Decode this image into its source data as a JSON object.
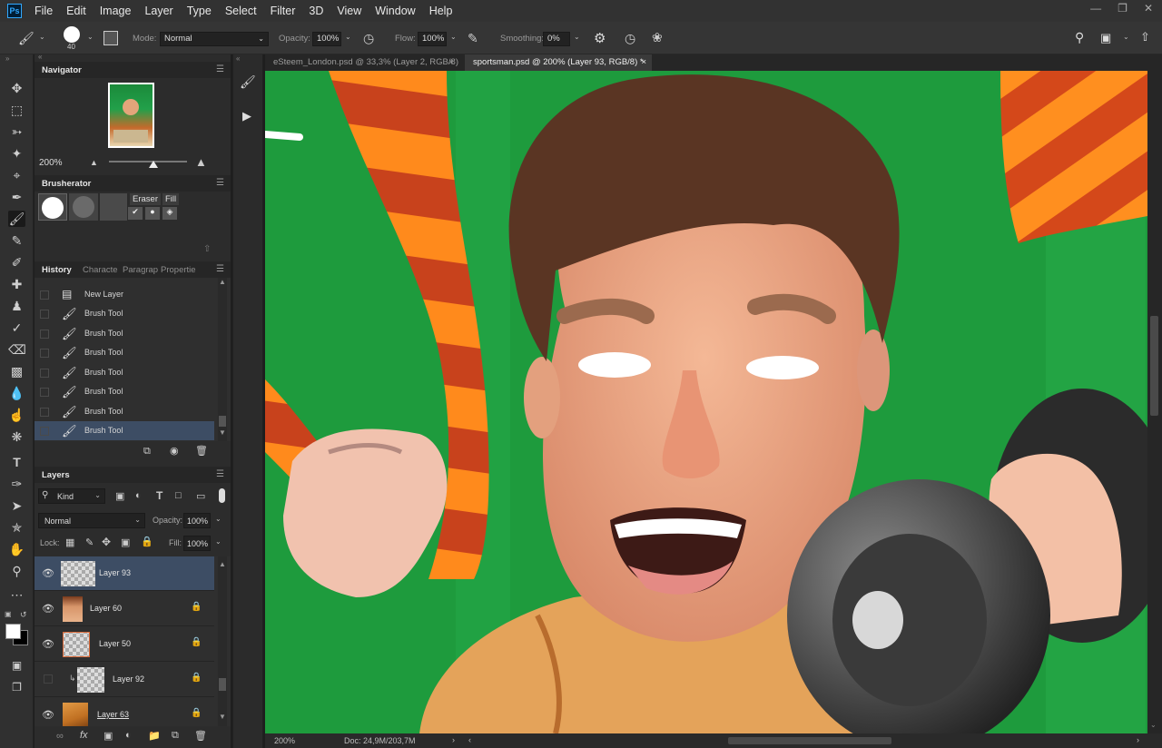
{
  "app": {
    "logo": "Ps",
    "menu": [
      "File",
      "Edit",
      "Image",
      "Layer",
      "Type",
      "Select",
      "Filter",
      "3D",
      "View",
      "Window",
      "Help"
    ]
  },
  "options": {
    "brush_size": "40",
    "mode_label": "Mode:",
    "mode_value": "Normal",
    "opacity_label": "Opacity:",
    "opacity_value": "100%",
    "flow_label": "Flow:",
    "flow_value": "100%",
    "smoothing_label": "Smoothing:",
    "smoothing_value": "0%"
  },
  "navigator": {
    "title": "Navigator",
    "zoom": "200%"
  },
  "brusherator": {
    "title": "Brusherator",
    "eraser_label": "Eraser",
    "fill_label": "Fill"
  },
  "history": {
    "tabs": [
      "History",
      "Characte",
      "Paragrap",
      "Propertie"
    ],
    "items": [
      "New Layer",
      "Brush Tool",
      "Brush Tool",
      "Brush Tool",
      "Brush Tool",
      "Brush Tool",
      "Brush Tool",
      "Brush Tool"
    ],
    "active_index": 7
  },
  "layers": {
    "title": "Layers",
    "filter_kind": "Kind",
    "blend_mode": "Normal",
    "opacity_label": "Opacity:",
    "opacity_value": "100%",
    "lock_label": "Lock:",
    "fill_label": "Fill:",
    "fill_value": "100%",
    "items": [
      "Layer 93",
      "Layer 60",
      "Layer 50",
      "Layer 92",
      "Layer 63"
    ],
    "active_index": 0
  },
  "documents": {
    "tab1": "eSteem_London.psd @ 33,3% (Layer 2, RGB/8)",
    "tab2": "sportsman.psd @ 200% (Layer 93, RGB/8) *",
    "active_index": 1
  },
  "status": {
    "zoom": "200%",
    "doc": "Doc: 24,9M/203,7M"
  },
  "colors": {
    "accent": "#31a8ff",
    "canvas_green": "#1f9a3b",
    "selection": "#3d4d64"
  }
}
